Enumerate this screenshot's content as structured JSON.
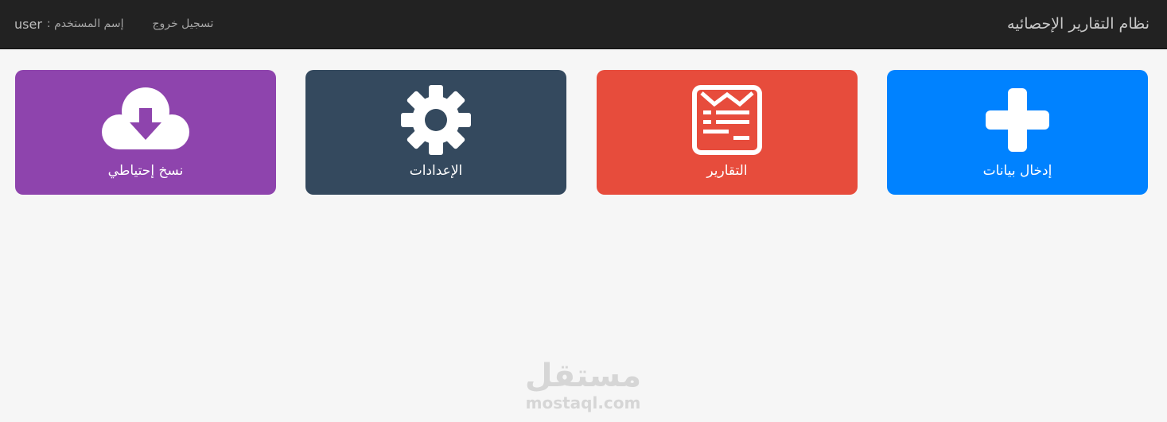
{
  "navbar": {
    "brand": "نظام التقارير الإحصائيه",
    "user_label": "إسم المستخدم :",
    "username": "user",
    "logout": "تسجيل خروج",
    "background": "#222222"
  },
  "tiles": [
    {
      "label": "إدخال بيانات",
      "icon": "plus-icon",
      "color": "#0082ff"
    },
    {
      "label": "التقارير",
      "icon": "report-document-icon",
      "color": "#e74c3c"
    },
    {
      "label": "الإعدادات",
      "icon": "gear-icon",
      "color": "#34495e"
    },
    {
      "label": "نسخ إحتياطي",
      "icon": "cloud-download-icon",
      "color": "#8e44ad"
    }
  ],
  "watermark": {
    "arabic": "مستقل",
    "domain": "mostaql.com"
  }
}
